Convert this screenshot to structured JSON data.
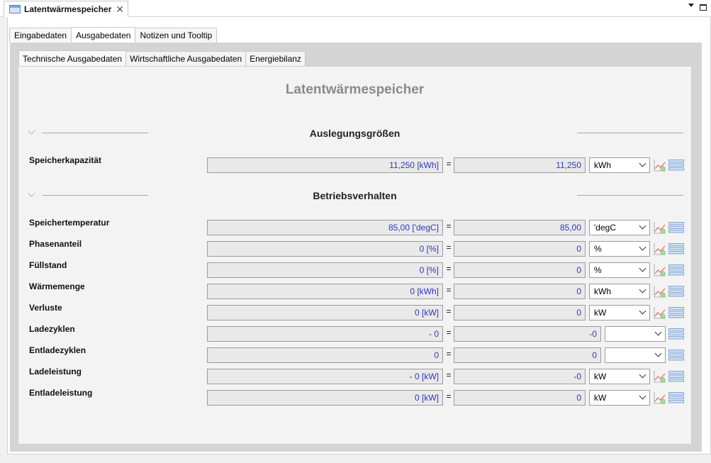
{
  "editor_tab": {
    "title": "Latentwärmespeicher",
    "close_glyph": "✕"
  },
  "tabs_level1": [
    "Eingabedaten",
    "Ausgabedaten",
    "Notizen und Tooltip"
  ],
  "tabs_level1_active": "Ausgabedaten",
  "tabs_level2": [
    "Technische Ausgabedaten",
    "Wirtschaftliche Ausgabedaten",
    "Energiebilanz"
  ],
  "tabs_level2_active": "Technische Ausgabedaten",
  "page_title": "Latentwärmespeicher",
  "sections": {
    "auslegung": {
      "title": "Auslegungsgrößen",
      "rows": [
        {
          "label": "Speicherkapazität",
          "value": "11,250 [kWh]",
          "converted": "11,250",
          "unit": "kWh"
        }
      ]
    },
    "betrieb": {
      "title": "Betriebsverhalten",
      "rows": [
        {
          "label": "Speichertemperatur",
          "value": "85,00 ['degC]",
          "converted": "85,00",
          "unit": "'degC"
        },
        {
          "label": "Phasenanteil",
          "value": "0 [%]",
          "converted": "0",
          "unit": "%"
        },
        {
          "label": "Füllstand",
          "value": "0 [%]",
          "converted": "0",
          "unit": "%"
        },
        {
          "label": "Wärmemenge",
          "value": "0 [kWh]",
          "converted": "0",
          "unit": "kWh"
        },
        {
          "label": "Verluste",
          "value": "0 [kW]",
          "converted": "0",
          "unit": "kW"
        },
        {
          "label": "Ladezyklen",
          "value": "- 0",
          "converted": "-0",
          "unit": ""
        },
        {
          "label": "Entladezyklen",
          "value": "0",
          "converted": "0",
          "unit": ""
        },
        {
          "label": "Ladeleistung",
          "value": "- 0 [kW]",
          "converted": "-0",
          "unit": "kW"
        },
        {
          "label": "Entladeleistung",
          "value": "0 [kW]",
          "converted": "0",
          "unit": "kW"
        }
      ]
    }
  },
  "equals_sign": "=",
  "icons": {
    "chart": "chart-line-icon",
    "list": "list-icon",
    "doc": "document-icon",
    "collapse": "chevron-down-icon"
  },
  "colors": {
    "value_text": "#2b3ab5",
    "title_grey": "#8a8a8a",
    "frame_grey": "#d4d4d4"
  }
}
